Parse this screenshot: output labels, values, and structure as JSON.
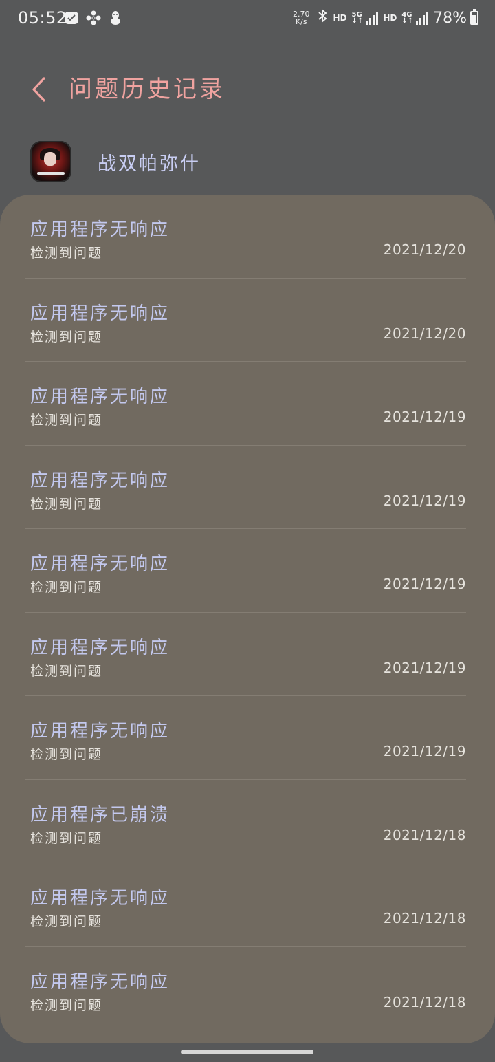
{
  "status_bar": {
    "time": "05:52",
    "net_speed_value": "2.70",
    "net_speed_unit": "K/s",
    "hd1": "HD",
    "sig1_tag_top": "5G",
    "sig1_tag_bottom": "↓↑",
    "hd2": "HD",
    "sig2_tag_top": "4G",
    "sig2_tag_bottom": "↓↑",
    "battery": "78%",
    "icons": [
      "check-badge-icon",
      "fan-icon",
      "penguin-icon",
      "bluetooth-icon",
      "signal-icon",
      "battery-icon"
    ]
  },
  "header": {
    "title": "问题历史记录",
    "back_icon": "chevron-left-icon",
    "accent_color": "#f0a3a0"
  },
  "app": {
    "name": "战双帕弥什"
  },
  "history": [
    {
      "title": "应用程序无响应",
      "subtitle": "检测到问题",
      "date": "2021/12/20"
    },
    {
      "title": "应用程序无响应",
      "subtitle": "检测到问题",
      "date": "2021/12/20"
    },
    {
      "title": "应用程序无响应",
      "subtitle": "检测到问题",
      "date": "2021/12/19"
    },
    {
      "title": "应用程序无响应",
      "subtitle": "检测到问题",
      "date": "2021/12/19"
    },
    {
      "title": "应用程序无响应",
      "subtitle": "检测到问题",
      "date": "2021/12/19"
    },
    {
      "title": "应用程序无响应",
      "subtitle": "检测到问题",
      "date": "2021/12/19"
    },
    {
      "title": "应用程序无响应",
      "subtitle": "检测到问题",
      "date": "2021/12/19"
    },
    {
      "title": "应用程序已崩溃",
      "subtitle": "检测到问题",
      "date": "2021/12/18"
    },
    {
      "title": "应用程序无响应",
      "subtitle": "检测到问题",
      "date": "2021/12/18"
    },
    {
      "title": "应用程序无响应",
      "subtitle": "检测到问题",
      "date": "2021/12/18"
    }
  ]
}
